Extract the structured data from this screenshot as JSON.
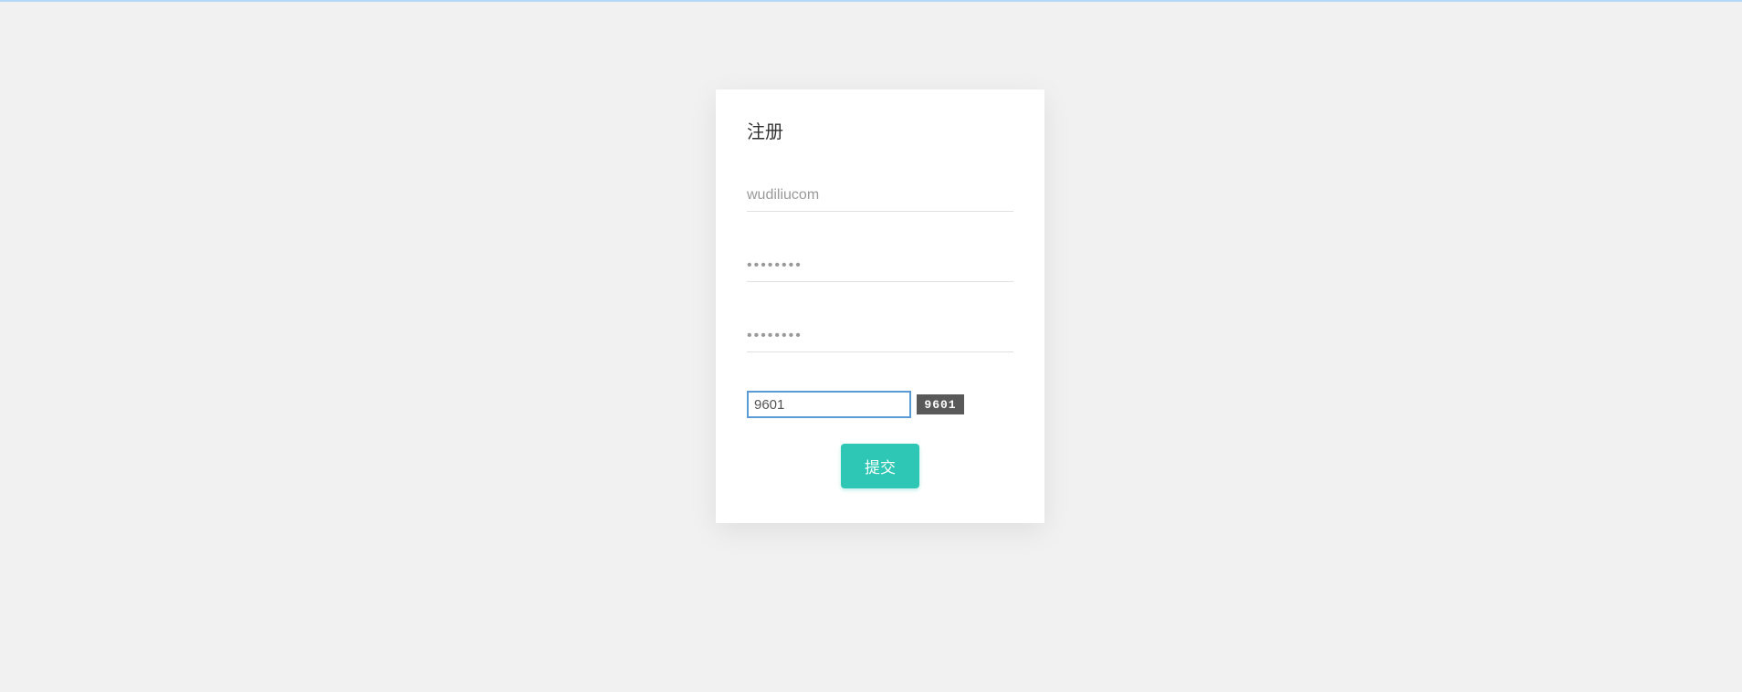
{
  "form": {
    "title": "注册",
    "username_value": "wudiliucom",
    "password_value": "········",
    "confirm_password_value": "········",
    "captcha_value": "9601",
    "captcha_image_text": "9601",
    "submit_label": "提交"
  }
}
